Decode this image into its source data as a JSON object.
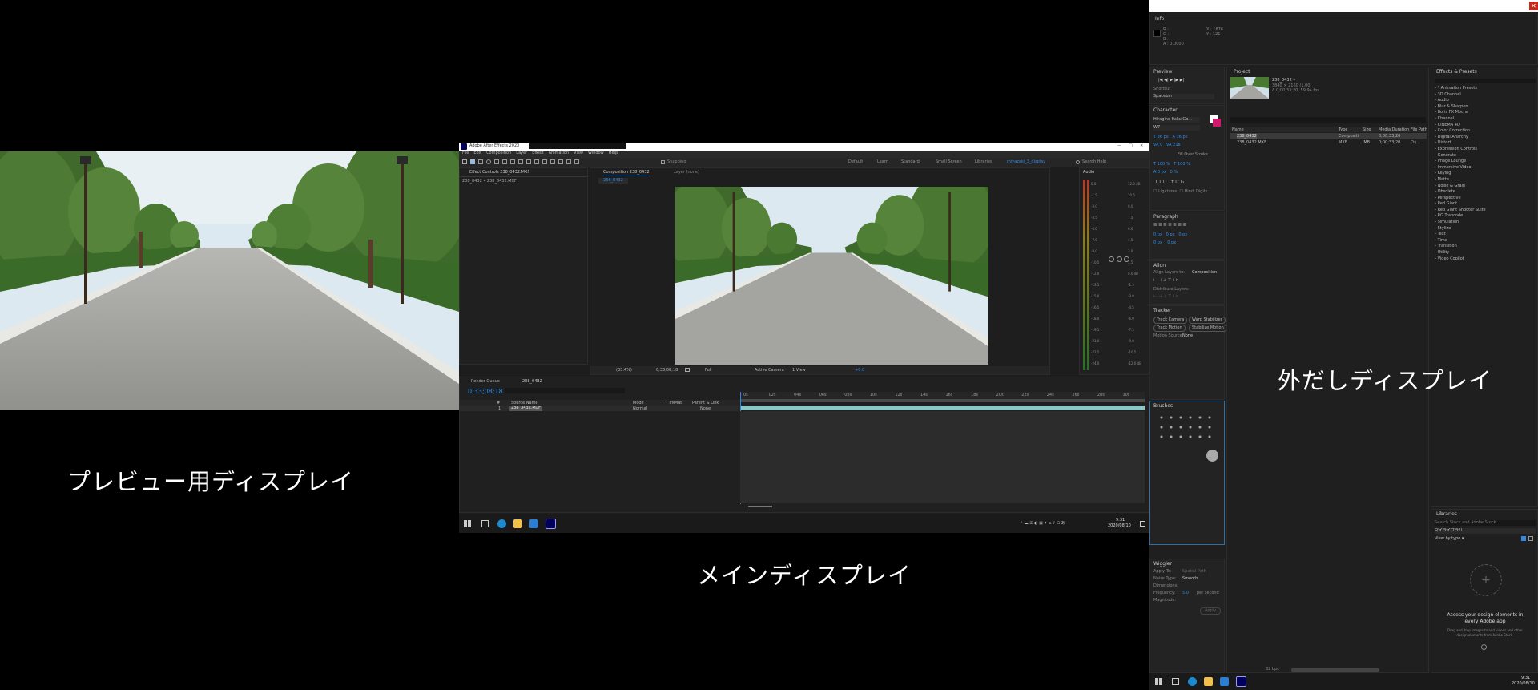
{
  "captions": {
    "preview_display": "プレビュー用ディスプレイ",
    "main_display": "メインディスプレイ",
    "external_display": "外だしディスプレイ"
  },
  "ae_main": {
    "window_title": "Adobe After Effects 2020",
    "menu": [
      "File",
      "Edit",
      "Composition",
      "Layer",
      "Effect",
      "Animation",
      "View",
      "Window",
      "Help"
    ],
    "snapping": "Snapping",
    "workspaces": [
      "Default",
      "Learn",
      "Standard",
      "Small Screen",
      "Libraries"
    ],
    "active_workspace": "miyazaki_3_display",
    "search_help": "Search Help",
    "effect_controls_tab": "Effect Controls 238_0432.MXF",
    "effect_controls_breadcrumb": "238_0432 • 238_0432.MXF",
    "composition_tab": "Composition 238_0432",
    "layer_tab": "Layer (none)",
    "comp_subtab": "238_0432",
    "viewer_zoom": "(33.4%)",
    "viewer_time": "0;33;08;18",
    "viewer_res": "Full",
    "viewer_camera": "Active Camera",
    "viewer_views": "1 View",
    "viewer_exposure": "+0.0",
    "audio_tab": "Audio",
    "audio_db_left": [
      "0.0",
      "-1.5",
      "-3.0",
      "-4.5",
      "-6.0",
      "-7.5",
      "-9.0",
      "-10.5",
      "-12.0",
      "-13.5",
      "-15.0",
      "-16.5",
      "-18.0",
      "-19.5",
      "-21.0",
      "-22.5",
      "-24.0"
    ],
    "audio_db_right": [
      "12.0 dB",
      "10.5",
      "9.0",
      "7.5",
      "6.0",
      "4.5",
      "3.0",
      "1.5",
      "0.0 dB",
      "-1.5",
      "-3.0",
      "-4.5",
      "-6.0",
      "-7.5",
      "-9.0",
      "-10.5",
      "-12.0 dB"
    ],
    "render_queue_tab": "Render Queue",
    "timeline_tab": "238_0432",
    "timecode": "0;33;08;18",
    "layer_columns": [
      "#",
      "Source Name",
      "Mode",
      "T TrkMat",
      "Parent & Link"
    ],
    "layer_row": {
      "index": "1",
      "name": "238_0432.MXF",
      "mode": "Normal",
      "parent": "None"
    },
    "ruler": [
      "0s",
      "02s",
      "04s",
      "06s",
      "08s",
      "10s",
      "12s",
      "14s",
      "16s",
      "18s",
      "20s",
      "22s",
      "24s",
      "26s",
      "28s",
      "30s"
    ],
    "clock_time": "9:31",
    "clock_date": "2020/08/10"
  },
  "ae_ext": {
    "info_tab": "Info",
    "info_values": [
      "R :",
      "G :",
      "B :",
      "A : 0.0000",
      "X : 1876",
      "Y : 121"
    ],
    "preview_tab": "Preview",
    "shortcut_label": "Shortcut",
    "shortcut_value": "Spacebar",
    "character_tab": "Character",
    "font_name": "Hiragino Kaku Go...",
    "font_style": "W7",
    "stroke_label": "Fill Over Stroke",
    "paragraph_tab": "Paragraph",
    "align_tab": "Align",
    "align_to_label": "Align Layers to:",
    "align_to_value": "Composition",
    "distribute_label": "Distribute Layers:",
    "tracker_tab": "Tracker",
    "tracker_buttons": [
      "Track Camera",
      "Warp Stabilizer",
      "Track Motion",
      "Stabilize Motion"
    ],
    "motion_source_label": "Motion Source:",
    "motion_source_value": "None",
    "brushes_tab": "Brushes",
    "wiggler_tab": "Wiggler",
    "wiggler_apply_to": "Apply To:",
    "wiggler_apply_value": "Spatial Path",
    "wiggler_noise_type": "Noise Type:",
    "wiggler_noise_value": "Smooth",
    "wiggler_dimensions": "Dimensions:",
    "wiggler_frequency": "Frequency:",
    "wiggler_frequency_value": "5.0",
    "wiggler_frequency_unit": "per second",
    "wiggler_magnitude": "Magnitude:",
    "wiggler_apply_button": "Apply",
    "project_tab": "Project",
    "project_item_name": "238_0432 ▾",
    "project_item_info": [
      "3840 × 2160 (1.00)",
      "Δ 0;00;33;20, 59.94 fps"
    ],
    "project_columns": [
      "Name",
      "Type",
      "Size",
      "Media Duration",
      "File Path"
    ],
    "project_rows": [
      {
        "name": "238_0432",
        "type": "Compositi",
        "size": "",
        "duration": "0;00;33;20",
        "path": ""
      },
      {
        "name": "238_0432.MXF",
        "type": "MXF",
        "size": "... MB",
        "duration": "0;00;33;20",
        "path": "D:\\..."
      }
    ],
    "project_bpc": "32 bpc",
    "effects_tab": "Effects & Presets",
    "effects_list": [
      "* Animation Presets",
      "3D Channel",
      "Audio",
      "Blur & Sharpen",
      "Boris FX Mocha",
      "Channel",
      "CINEMA 4D",
      "Color Correction",
      "Digital Anarchy",
      "Distort",
      "Expression Controls",
      "Generate",
      "Image Lounge",
      "Immersive Video",
      "Keying",
      "Matte",
      "Noise & Grain",
      "Obsolete",
      "Perspective",
      "Red Giant",
      "Red Giant Shooter Suite",
      "RG Trapcode",
      "Simulation",
      "Stylize",
      "Text",
      "Time",
      "Transition",
      "Utility",
      "Video Copilot"
    ],
    "libraries_tab": "Libraries",
    "libraries_search": "Search Stock and Adobe Stock",
    "libraries_mylib": "マイライブラリ",
    "libraries_view": "View by type ▾",
    "libraries_heading": "Access your design elements in every Adobe app",
    "libraries_sub": "Drag and drop images to add videos and other design elements from Adobe Stock.",
    "clock_time": "9:31",
    "clock_date": "2020/08/10"
  },
  "colors": {
    "ae_blue": "#2d8ceb",
    "ae_purple_icon": "#9999ff",
    "panel_bg": "#232323",
    "cyan_track": "#8ec6c5"
  }
}
